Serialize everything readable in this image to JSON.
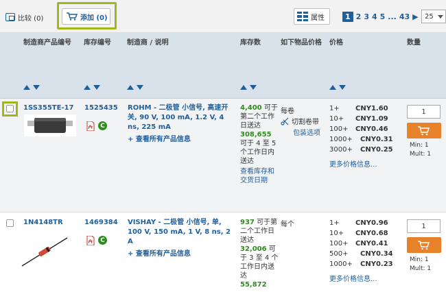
{
  "toolbar": {
    "compare_label": "比较 (0)",
    "add_label": "添加 (0)",
    "attributes_label": "属性",
    "pager": {
      "current": "1",
      "pages": [
        "2",
        "3",
        "4",
        "5"
      ],
      "ellipsis": "...",
      "last": "43",
      "next": "▶"
    },
    "per_page": "25"
  },
  "header": {
    "mfr_part_no": "制造商产品编号",
    "stock_no": "库存编号",
    "mfr_desc": "制造商 / 说明",
    "stock": "库存数",
    "pack_type": "如下物品价格",
    "price": "价格",
    "qty": "数量"
  },
  "rows": [
    {
      "mfr_part_no": "1SS355TE-17",
      "stock_no": "1525435",
      "description": "ROHM - 二极管 小信号, 高速开关, 90 V, 100 mA, 1.2 V, 4 ns, 225 mA",
      "see_all": "+ 查看所有产品信息",
      "avail1_qty": "4,400",
      "avail1_text": "可于第二个工作日送达",
      "avail2_qty": "308,655",
      "avail2_text": "可于 4 至 5 个工作日内送达",
      "avail_link": "查看库存和交货日期",
      "pack": "每卷",
      "pack_type": "切割卷带",
      "pack_option": "包装选项",
      "prices": [
        {
          "qty": "1+",
          "price": "CNY1.60"
        },
        {
          "qty": "10+",
          "price": "CNY1.09"
        },
        {
          "qty": "100+",
          "price": "CNY0.46"
        },
        {
          "qty": "1000+",
          "price": "CNY0.31"
        },
        {
          "qty": "3000+",
          "price": "CNY0.25"
        }
      ],
      "more_prices": "更多价格信息...",
      "qty": "1",
      "min": "Min: 1",
      "mult": "Mult: 1"
    },
    {
      "mfr_part_no": "1N4148TR",
      "stock_no": "1469384",
      "description": "VISHAY - 二极管 小信号, 单, 100 V, 150 mA, 1 V, 8 ns, 2 A",
      "see_all": "+ 查看所有产品信息",
      "avail1_qty": "937",
      "avail1_text": "可于第二个工作日送达",
      "avail2_qty": "32,006",
      "avail2_text": "可于 3 至 4 个工作日内送达",
      "avail3_qty": "55,872",
      "pack": "每个",
      "prices": [
        {
          "qty": "1+",
          "price": "CNY0.96"
        },
        {
          "qty": "10+",
          "price": "CNY0.68"
        },
        {
          "qty": "100+",
          "price": "CNY0.41"
        },
        {
          "qty": "500+",
          "price": "CNY0.34"
        },
        {
          "qty": "1000+",
          "price": "CNY0.23"
        }
      ],
      "more_prices": "更多价格信息...",
      "qty": "1",
      "min": "Min: 1",
      "mult": "Mult: 1"
    }
  ],
  "colors": {
    "link": "#1f5f9c",
    "stock": "#2e8b1e",
    "cart": "#e8822a",
    "highlight": "#a3b51c"
  }
}
